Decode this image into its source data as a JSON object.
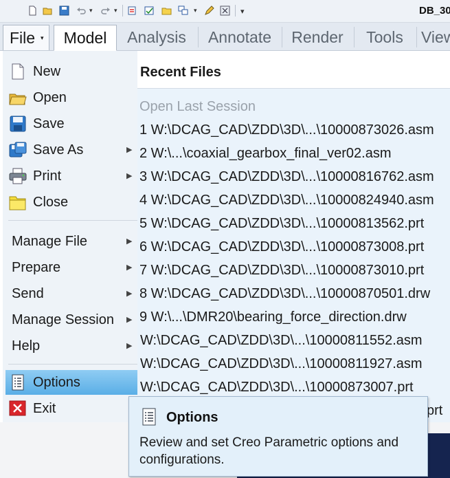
{
  "window": {
    "doc_title": "DB_30"
  },
  "quick_access_toolbar": {
    "icons": [
      "new-icon",
      "open-icon",
      "save-icon",
      "undo-icon",
      "redo-icon",
      "regenerate-icon",
      "select-window-icon",
      "open-folder-icon",
      "windows-icon",
      "edit-icon",
      "close-window-icon",
      "customize-icon"
    ]
  },
  "ribbon": {
    "file_label": "File",
    "tabs": [
      {
        "label": "Model",
        "active": true
      },
      {
        "label": "Analysis"
      },
      {
        "label": "Annotate"
      },
      {
        "label": "Render"
      },
      {
        "label": "Tools"
      },
      {
        "label": "View"
      }
    ]
  },
  "file_menu": {
    "items": [
      {
        "label": "New",
        "icon": "new-file-icon"
      },
      {
        "label": "Open",
        "icon": "open-folder-icon"
      },
      {
        "label": "Save",
        "icon": "save-disk-icon"
      },
      {
        "label": "Save As",
        "icon": "save-as-icon",
        "submenu": true
      },
      {
        "label": "Print",
        "icon": "printer-icon",
        "submenu": true
      },
      {
        "label": "Close",
        "icon": "close-folder-icon"
      }
    ],
    "groups": [
      {
        "label": "Manage File",
        "submenu": true
      },
      {
        "label": "Prepare",
        "submenu": true
      },
      {
        "label": "Send",
        "submenu": true
      },
      {
        "label": "Manage Session",
        "submenu": true
      },
      {
        "label": "Help",
        "submenu": true
      }
    ],
    "options": {
      "label": "Options",
      "icon": "options-list-icon",
      "selected": true
    },
    "exit": {
      "label": "Exit",
      "icon": "exit-x-icon"
    }
  },
  "recent_files": {
    "title": "Recent Files",
    "open_last_session": "Open Last Session",
    "files": [
      "1 W:\\DCAG_CAD\\ZDD\\3D\\...\\10000873026.asm",
      "2 W:\\...\\coaxial_gearbox_final_ver02.asm",
      "3 W:\\DCAG_CAD\\ZDD\\3D\\...\\10000816762.asm",
      "4 W:\\DCAG_CAD\\ZDD\\3D\\...\\10000824940.asm",
      "5 W:\\DCAG_CAD\\ZDD\\3D\\...\\10000813562.prt",
      "6 W:\\DCAG_CAD\\ZDD\\3D\\...\\10000873008.prt",
      "7 W:\\DCAG_CAD\\ZDD\\3D\\...\\10000873010.prt",
      "8 W:\\DCAG_CAD\\ZDD\\3D\\...\\10000870501.drw",
      "9 W:\\...\\DMR20\\bearing_force_direction.drw",
      " W:\\DCAG_CAD\\ZDD\\3D\\...\\10000811552.asm",
      " W:\\DCAG_CAD\\ZDD\\3D\\...\\10000811927.asm",
      " W:\\DCAG_CAD\\ZDD\\3D\\...\\10000873007.prt",
      "prt"
    ]
  },
  "tooltip": {
    "title": "Options",
    "description": "Review and set Creo Parametric options and configurations.",
    "icon": "options-list-icon"
  }
}
